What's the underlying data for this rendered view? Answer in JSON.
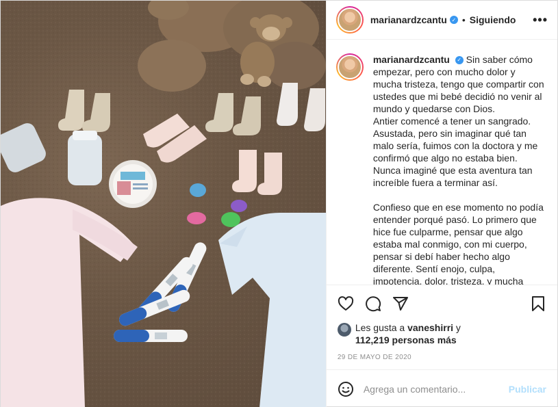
{
  "photo": {
    "label": ""
  },
  "header": {
    "username": "marianardzcantu",
    "separator": "•",
    "follow_status": "Siguiendo",
    "more_label": "•••"
  },
  "caption": {
    "username": "marianardzcantu",
    "text": "Sin saber cómo empezar, pero con mucho dolor y mucha tristeza, tengo que compartir con ustedes que mi bebé decidió no venir al mundo y quedarse con Dios.\nAntier comencé a tener un sangrado. Asustada, pero sin imaginar qué tan malo sería, fuimos con la doctora y me confirmó que algo no estaba bien. Nunca imaginé que esta aventura tan increíble fuera a terminar así.\n\nConfieso que en ese momento no podía entender porqué pasó. Lo primero que hice fue culparme, pensar que algo estaba mal conmigo, con mi cuerpo, pensar si debí haber hecho algo diferente. Sentí enojo, culpa, impotencia, dolor, tristeza, y mucha confusión. No"
  },
  "likes": {
    "prefix": "Les gusta a ",
    "user": "vaneshirri",
    "conj": " y",
    "count": "112,219 personas más"
  },
  "date": "29 DE MAYO DE 2020",
  "comment": {
    "placeholder": "Agrega un comentario...",
    "publish_label": "Publicar"
  },
  "colors": {
    "verified": "#3897f0",
    "publish_disabled": "#b2dffc",
    "muted": "#8e8e8e"
  },
  "icons": [
    "heart-icon",
    "comment-icon",
    "share-icon",
    "bookmark-icon",
    "emoji-icon",
    "verified-icon"
  ]
}
